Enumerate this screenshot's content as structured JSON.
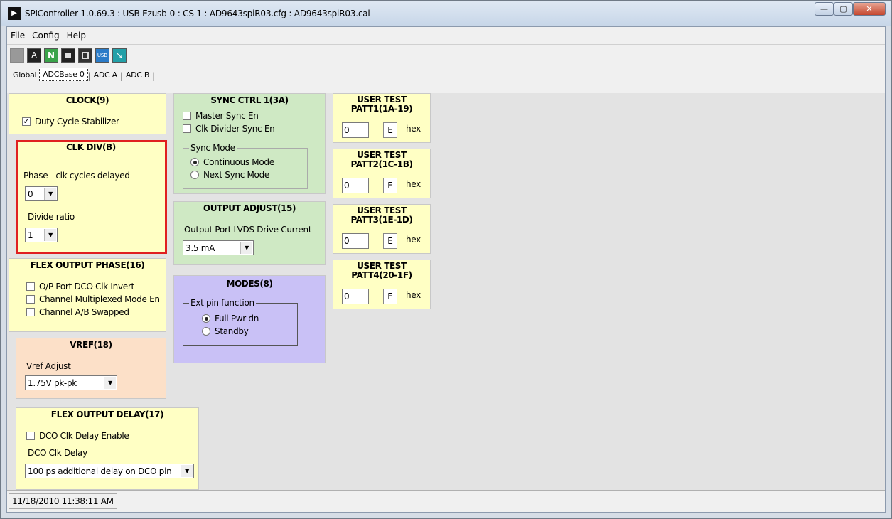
{
  "window": {
    "title": "SPIController 1.0.69.3 : USB Ezusb-0 : CS 1 : AD9643spiR03.cfg : AD9643spiR03.cal"
  },
  "menu": [
    "File",
    "Config",
    "Help"
  ],
  "toolbar_icons": [
    "blank-icon",
    "lock-icon",
    "n-icon",
    "chip-icon",
    "register-icon",
    "usb-icon",
    "waveform-icon"
  ],
  "tabs": [
    "Global",
    "ADCBase 0",
    "ADC A",
    "ADC B"
  ],
  "clock": {
    "title": "CLOCK(9)",
    "dcs": "Duty Cycle Stabilizer",
    "dcs_checked": true
  },
  "clkdiv": {
    "title": "CLK DIV(B)",
    "phase_label": "Phase - clk cycles delayed",
    "phase_value": "0",
    "divide_label": "Divide ratio",
    "divide_value": "1"
  },
  "flexphase": {
    "title": "FLEX OUTPUT PHASE(16)",
    "opt1": "O/P Port DCO Clk Invert",
    "opt2": "Channel Multiplexed Mode En",
    "opt3": "Channel A/B Swapped"
  },
  "vref": {
    "title": "VREF(18)",
    "label": "Vref Adjust",
    "value": "1.75V pk-pk"
  },
  "flexdelay": {
    "title": "FLEX OUTPUT DELAY(17)",
    "enable": "DCO Clk Delay Enable",
    "label": "DCO Clk Delay",
    "value": "100 ps additional delay on DCO pin"
  },
  "sync": {
    "title": "SYNC CTRL 1(3A)",
    "master": "Master Sync En",
    "clkdiv": "Clk Divider Sync En",
    "group": "Sync Mode",
    "mode1": "Continuous Mode",
    "mode2": "Next Sync Mode"
  },
  "outadj": {
    "title": "OUTPUT ADJUST(15)",
    "label": "Output Port LVDS Drive Current",
    "value": "3.5 mA"
  },
  "modes": {
    "title": "MODES(8)",
    "group": "Ext pin function",
    "opt1": "Full Pwr dn",
    "opt2": "Standby"
  },
  "patt": [
    {
      "title1": "USER TEST",
      "title2": "PATT1(1A-19)",
      "value": "0"
    },
    {
      "title1": "USER TEST",
      "title2": "PATT2(1C-1B)",
      "value": "0"
    },
    {
      "title1": "USER TEST",
      "title2": "PATT3(1E-1D)",
      "value": "0"
    },
    {
      "title1": "USER TEST",
      "title2": "PATT4(20-1F)",
      "value": "0"
    }
  ],
  "patt_btn": "E",
  "patt_unit": "hex",
  "status": {
    "datetime": "11/18/2010 11:38:11 AM"
  }
}
